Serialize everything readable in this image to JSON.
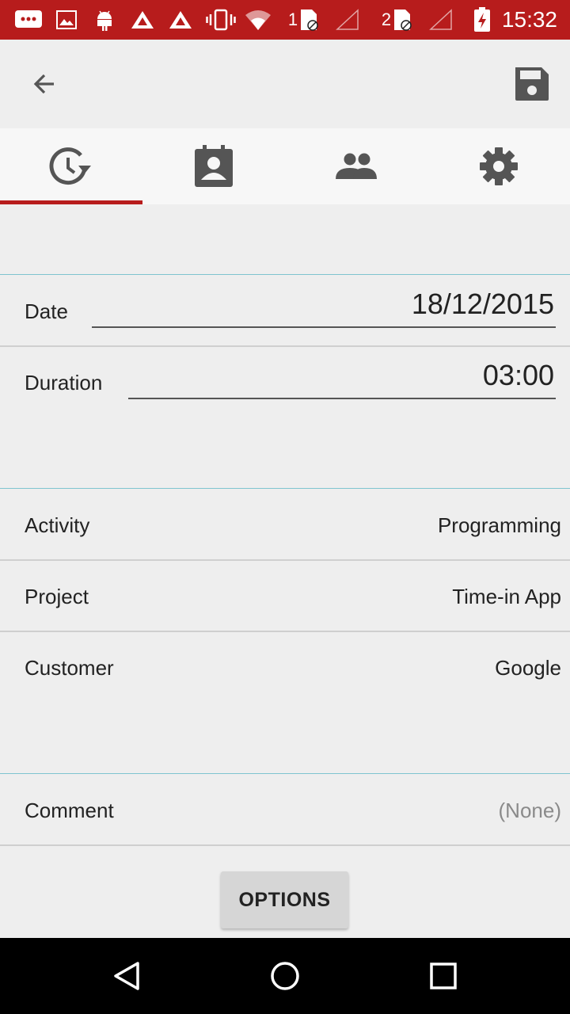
{
  "status_bar": {
    "time": "15:32",
    "sim1_label": "1",
    "sim2_label": "2",
    "background_color": "#b71c1c",
    "icons": [
      "message-icon",
      "image-icon",
      "android-icon",
      "app-icon",
      "app-icon",
      "vibrate-icon",
      "wifi-icon",
      "sim1-icon",
      "signal-icon",
      "sim2-icon",
      "signal-icon",
      "battery-charging-icon"
    ]
  },
  "toolbar": {
    "back_icon": "arrow-back-icon",
    "save_icon": "save-icon"
  },
  "tabs": [
    {
      "icon": "time-history-icon",
      "selected": true
    },
    {
      "icon": "contact-calendar-icon",
      "selected": false
    },
    {
      "icon": "people-icon",
      "selected": false
    },
    {
      "icon": "gear-icon",
      "selected": false
    }
  ],
  "form": {
    "date_label": "Date",
    "date_value": "18/12/2015",
    "duration_label": "Duration",
    "duration_value": "03:00",
    "activity_label": "Activity",
    "activity_value": "Programming",
    "project_label": "Project",
    "project_value": "Time-in App",
    "customer_label": "Customer",
    "customer_value": "Google",
    "comment_label": "Comment",
    "comment_value": "(None)"
  },
  "options_button": "OPTIONS",
  "nav_bar": [
    "back-triangle-icon",
    "home-circle-icon",
    "recents-square-icon"
  ],
  "colors": {
    "accent": "#b71c1c",
    "divider": "#7fc4cf"
  }
}
